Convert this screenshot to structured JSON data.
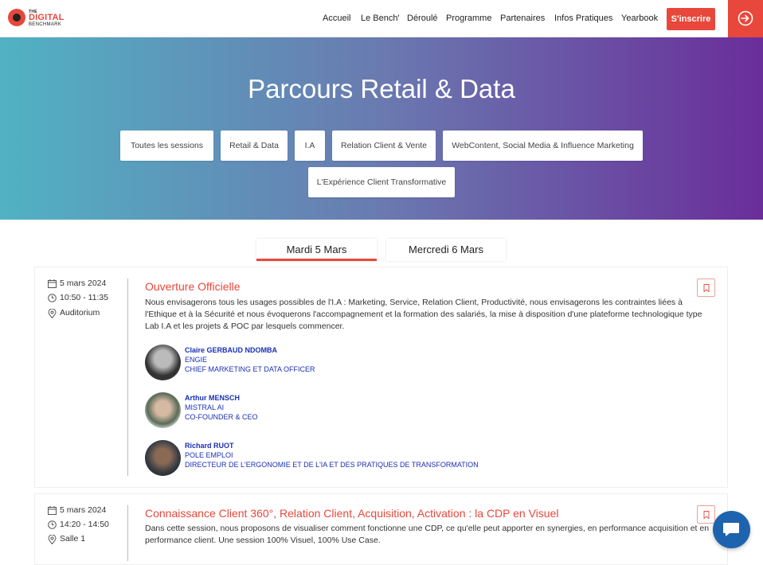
{
  "brand": {
    "the": "THE",
    "digital": "DIGITAL",
    "bench": "BENCHMARK"
  },
  "nav": {
    "items": [
      "Accueil",
      "Le Bench'",
      "Déroulé",
      "Programme",
      "Partenaires",
      "Infos Pratiques",
      "Yearbook"
    ],
    "cta": "S'inscrire"
  },
  "hero": {
    "title": "Parcours Retail & Data",
    "filters": [
      "Toutes les sessions",
      "Retail & Data",
      "I.A",
      "Relation Client & Vente",
      "WebContent, Social Media & Influence Marketing",
      "L'Expérience Client Transformative"
    ]
  },
  "tabs": {
    "day1": "Mardi 5 Mars",
    "day2": "Mercredi 6 Mars"
  },
  "sessions": [
    {
      "date": "5 mars 2024",
      "time": "10:50 - 11:35",
      "room": "Auditorium",
      "title": "Ouverture Officielle",
      "description": "Nous envisagerons tous les usages possibles de l'I.A : Marketing, Service, Relation Client, Productivité, nous envisagerons les contraintes liées à l'Ethique et à la Sécurité et nous évoquerons l'accompagnement et la formation des salariés, la mise à disposition d'une plateforme technologique type Lab I.A et les projets & POC par lesquels commencer.",
      "speakers": [
        {
          "name": "Claire GERBAUD NDOMBA",
          "org": "ENGIE",
          "role": "CHIEF MARKETING ET DATA OFFICER"
        },
        {
          "name": "Arthur MENSCH",
          "org": "MISTRAL AI",
          "role": "CO-FOUNDER & CEO"
        },
        {
          "name": "Richard RUOT",
          "org": "POLE EMPLOI",
          "role": "DIRECTEUR DE L'ERGONOMIE ET DE L'IA ET DES PRATIQUES DE TRANSFORMATION"
        }
      ]
    },
    {
      "date": "5 mars 2024",
      "time": "14:20 - 14:50",
      "room": "Salle 1",
      "title": "Connaissance Client 360°, Relation Client, Acquisition, Activation : la CDP en Visuel",
      "description": "Dans cette session, nous proposons de visualiser comment fonctionne une CDP, ce qu'elle peut apporter en synergies, en performance acquisition et en performance client. Une session 100% Visuel, 100% Use Case."
    }
  ],
  "colors": {
    "accent": "#e8473b",
    "link": "#1a2fb5",
    "chat": "#1e63ad"
  }
}
